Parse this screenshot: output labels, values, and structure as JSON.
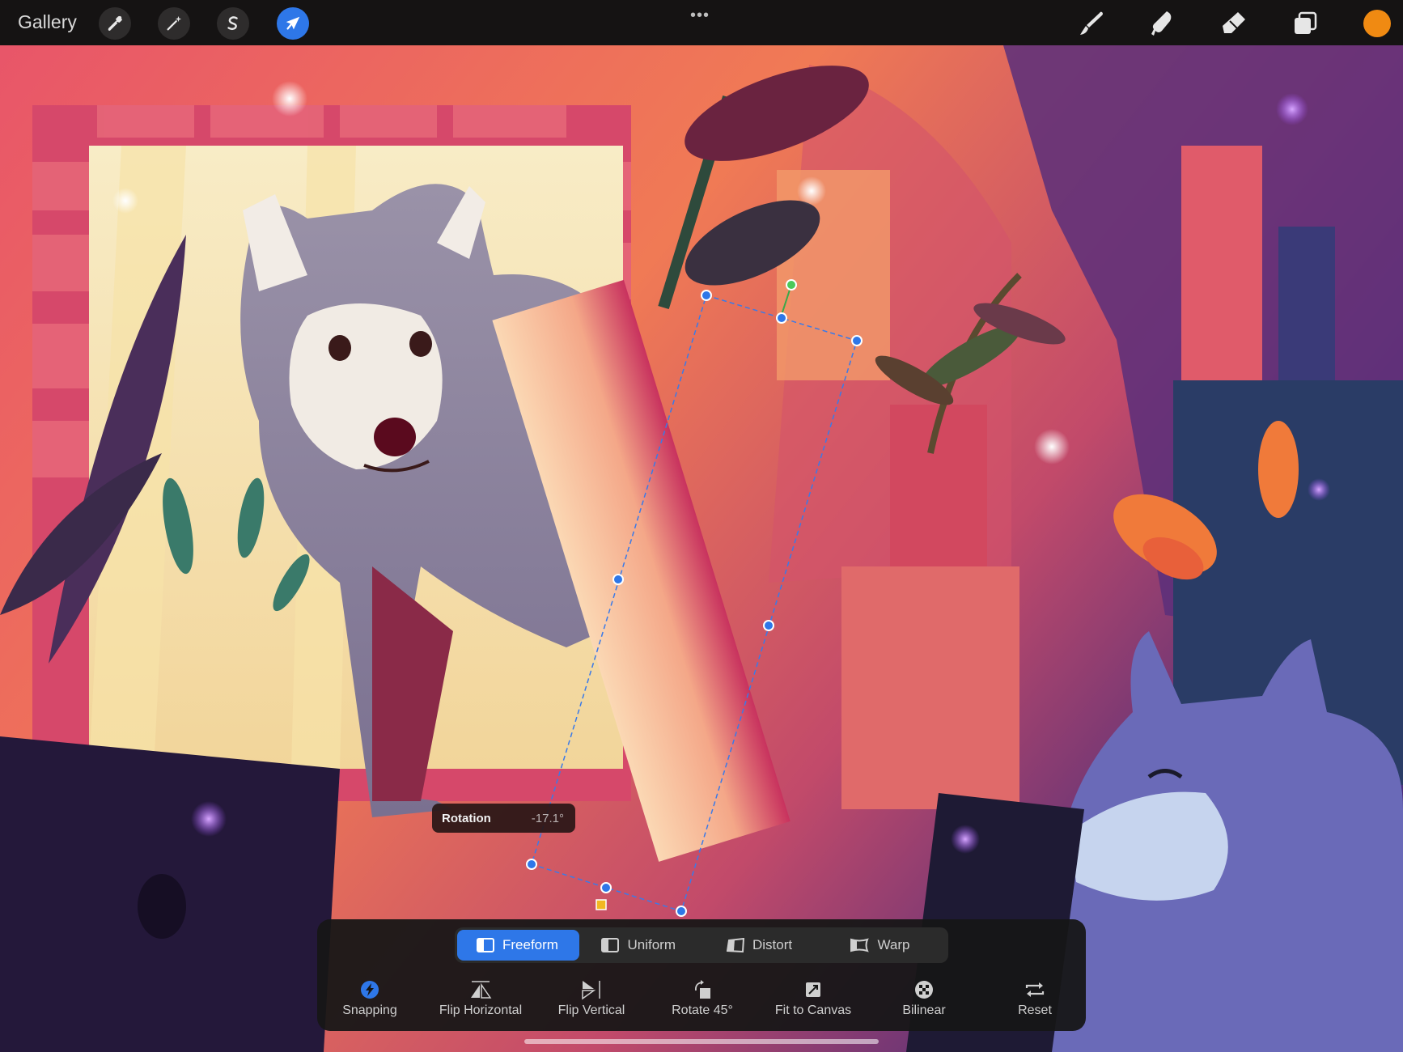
{
  "topbar": {
    "gallery_label": "Gallery",
    "left_tools": [
      {
        "name": "actions",
        "icon": "wrench-icon"
      },
      {
        "name": "adjustments",
        "icon": "magic-wand-icon"
      },
      {
        "name": "selection",
        "icon": "selection-s-icon"
      },
      {
        "name": "transform",
        "icon": "arrow-cursor-icon",
        "active": true
      }
    ],
    "more_label": "•••",
    "right_tools": [
      {
        "name": "brush",
        "icon": "brush-icon"
      },
      {
        "name": "smudge",
        "icon": "smudge-icon"
      },
      {
        "name": "eraser",
        "icon": "eraser-icon"
      },
      {
        "name": "layers",
        "icon": "layers-icon"
      }
    ],
    "current_color": "#f08a12"
  },
  "rotation": {
    "label": "Rotation",
    "value": "-17.1°"
  },
  "transform_panel": {
    "modes": [
      {
        "label": "Freeform",
        "icon": "freeform-icon",
        "active": true
      },
      {
        "label": "Uniform",
        "icon": "uniform-icon",
        "active": false
      },
      {
        "label": "Distort",
        "icon": "distort-icon",
        "active": false
      },
      {
        "label": "Warp",
        "icon": "warp-icon",
        "active": false
      }
    ],
    "actions": [
      {
        "label": "Snapping",
        "icon": "lightning-icon"
      },
      {
        "label": "Flip Horizontal",
        "icon": "flip-horizontal-icon"
      },
      {
        "label": "Flip Vertical",
        "icon": "flip-vertical-icon"
      },
      {
        "label": "Rotate 45°",
        "icon": "rotate-icon"
      },
      {
        "label": "Fit to Canvas",
        "icon": "fit-canvas-icon"
      },
      {
        "label": "Bilinear",
        "icon": "bilinear-icon"
      },
      {
        "label": "Reset",
        "icon": "reset-icon"
      }
    ]
  },
  "colors": {
    "accent": "#2e77e8",
    "toolbar_bg": "#151313",
    "snapping_active": "#2e77e8"
  }
}
